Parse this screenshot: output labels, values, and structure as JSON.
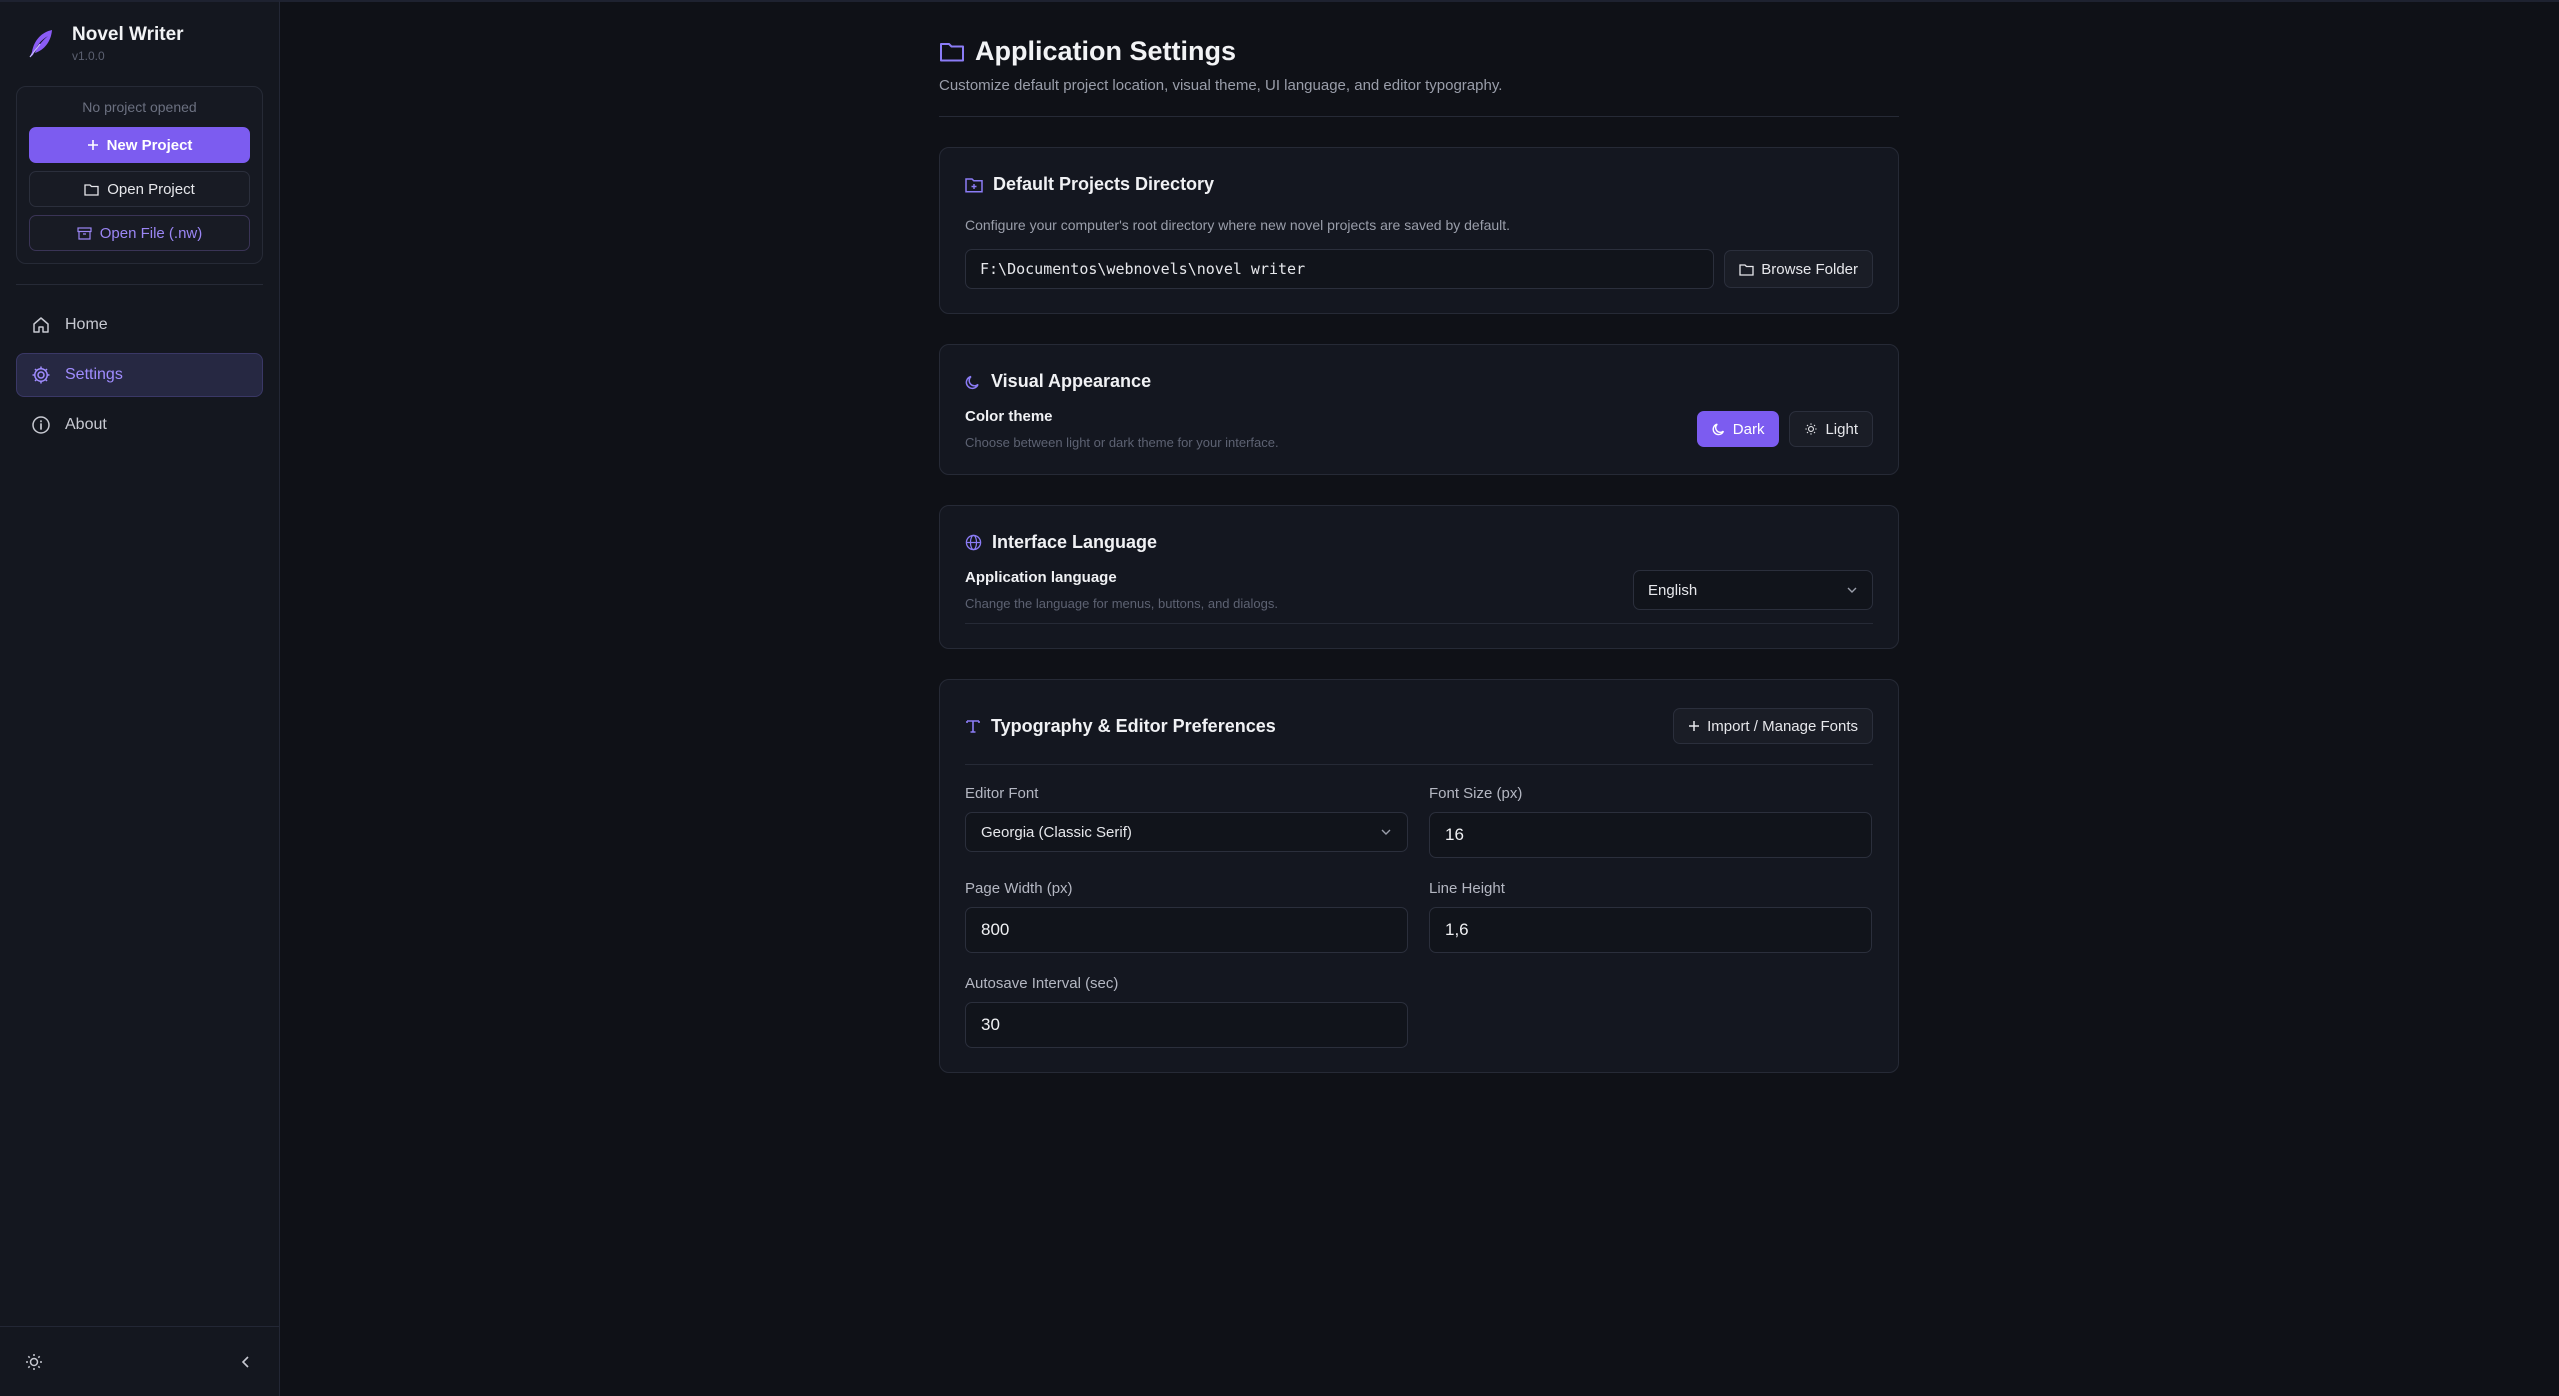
{
  "sidebar": {
    "app_name": "Novel Writer",
    "version": "v1.0.0",
    "no_project_text": "No project opened",
    "new_project_label": "New Project",
    "open_project_label": "Open Project",
    "open_file_label": "Open File (.nw)",
    "nav": [
      {
        "label": "Home",
        "icon": "home-icon"
      },
      {
        "label": "Settings",
        "icon": "gear-icon",
        "active": true
      },
      {
        "label": "About",
        "icon": "info-icon"
      }
    ]
  },
  "page": {
    "title": "Application Settings",
    "subtitle": "Customize default project location, visual theme, UI language, and editor typography."
  },
  "directory": {
    "title": "Default Projects Directory",
    "description": "Configure your computer's root directory where new novel projects are saved by default.",
    "path": "F:\\Documentos\\webnovels\\novel writer",
    "browse_label": "Browse Folder"
  },
  "appearance": {
    "title": "Visual Appearance",
    "label": "Color theme",
    "help": "Choose between light or dark theme for your interface.",
    "dark_label": "Dark",
    "light_label": "Light",
    "selected": "Dark"
  },
  "language": {
    "title": "Interface Language",
    "label": "Application language",
    "help": "Change the language for menus, buttons, and dialogs.",
    "value": "English"
  },
  "typography": {
    "title": "Typography & Editor Preferences",
    "import_label": "Import / Manage Fonts",
    "editor_font_label": "Editor Font",
    "editor_font_value": "Georgia (Classic Serif)",
    "font_size_label": "Font Size (px)",
    "font_size_value": "16",
    "page_width_label": "Page Width (px)",
    "page_width_value": "800",
    "line_height_label": "Line Height",
    "line_height_value": "1,6",
    "autosave_label": "Autosave Interval (sec)",
    "autosave_value": "30"
  },
  "colors": {
    "accent": "#7c5cf0",
    "background": "#0f1117",
    "sidebar": "#14171f"
  }
}
